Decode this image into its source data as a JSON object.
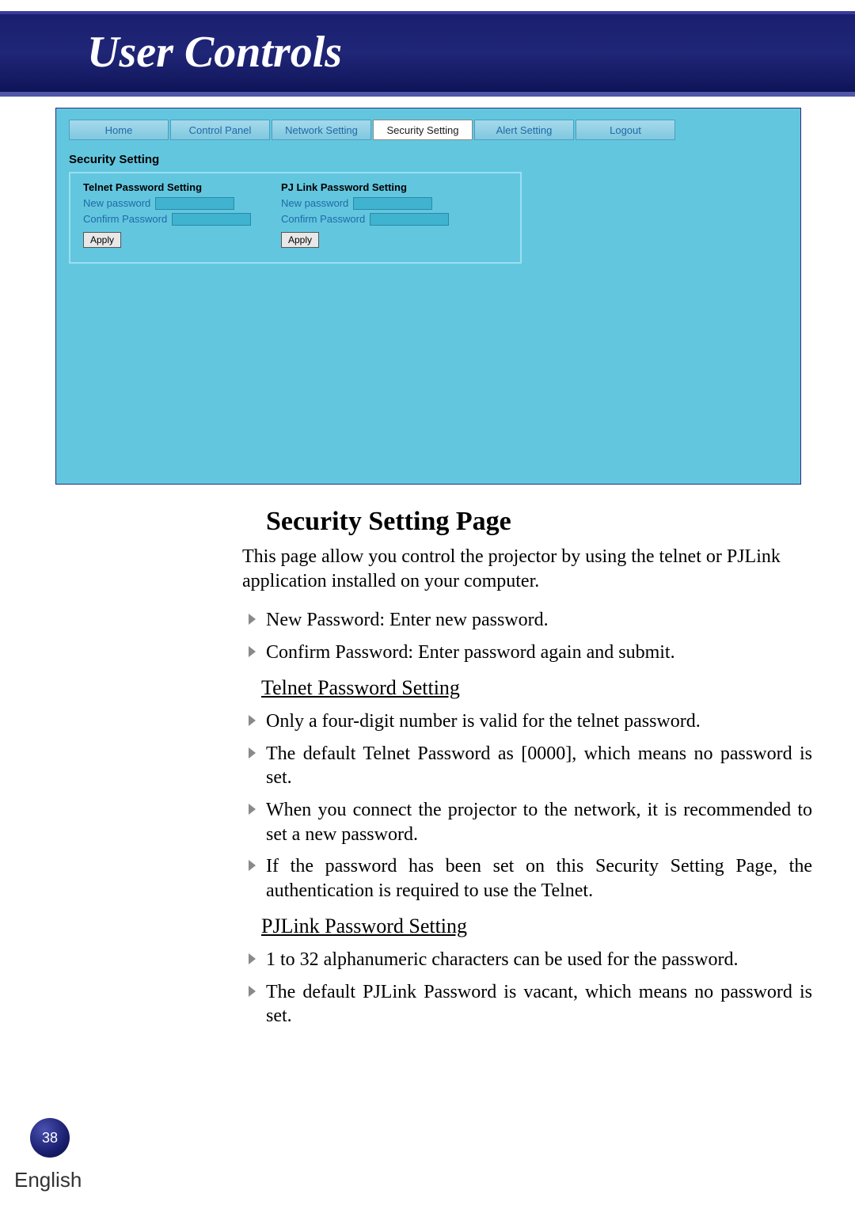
{
  "header": {
    "title": "User Controls"
  },
  "screenshot": {
    "tabs": {
      "home": "Home",
      "control_panel": "Control Panel",
      "network": "Network Setting",
      "security": "Security Setting",
      "alert": "Alert Setting",
      "logout": "Logout"
    },
    "section_title": "Security Setting",
    "telnet": {
      "heading": "Telnet Password Setting",
      "new_pw": "New password",
      "confirm_pw": "Confirm Password",
      "apply": "Apply"
    },
    "pjlink": {
      "heading": "PJ Link Password Setting",
      "new_pw": "New password",
      "confirm_pw": "Confirm Password",
      "apply": "Apply"
    }
  },
  "doc": {
    "h1": "Security Setting Page",
    "intro": "This page allow you control the projector by using the telnet or PJLink application installed on your computer.",
    "b1": "New Password: Enter new password.",
    "b2": "Confirm Password: Enter password again and submit.",
    "h2_telnet": "Telnet Password Setting",
    "t1": "Only a four-digit number is valid for the telnet password.",
    "t2": "The default Telnet Password as [0000], which means no password is set.",
    "t3": "When you connect the projector to the network, it is recommended to set a new password.",
    "t4": "If the password has been set on this Security Setting Page, the authentication is required to use the Telnet.",
    "h2_pjlink": "PJLink Password Setting",
    "p1": "1 to 32 alphanumeric characters can be used for the password.",
    "p2": "The default PJLink Password is vacant, which means no password is set."
  },
  "page_number": "38",
  "language": "English"
}
